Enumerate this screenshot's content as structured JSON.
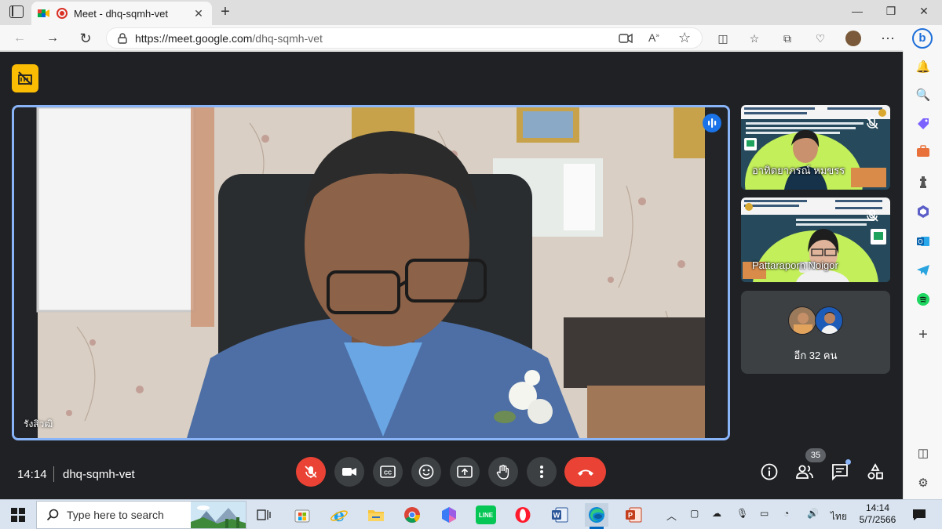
{
  "browser": {
    "tab_title": "Meet - dhq-sqmh-vet",
    "url_host": "https://meet.google.com",
    "url_path": "/dhq-sqmh-vet",
    "tab_close": "✕",
    "new_tab": "+"
  },
  "meeting": {
    "main_speaker_name": "รังสิวฒิ",
    "tiles": [
      {
        "name": "อาทิตยาภรณ์ หมขรร"
      },
      {
        "name": "Pattaraporn Noigor"
      }
    ],
    "more_participants": "อีก 32 คน",
    "time": "14:14",
    "code": "dhq-sqmh-vet",
    "participant_count": "35"
  },
  "taskbar": {
    "search_placeholder": "Type here to search",
    "language": "ไทย",
    "time": "14:14",
    "date": "5/7/2566"
  },
  "colors": {
    "meet_bg": "#202124",
    "active_border": "#8ab4f8",
    "mic_off": "#ea4335",
    "hangup": "#ea4335",
    "warning": "#fbbc04"
  }
}
